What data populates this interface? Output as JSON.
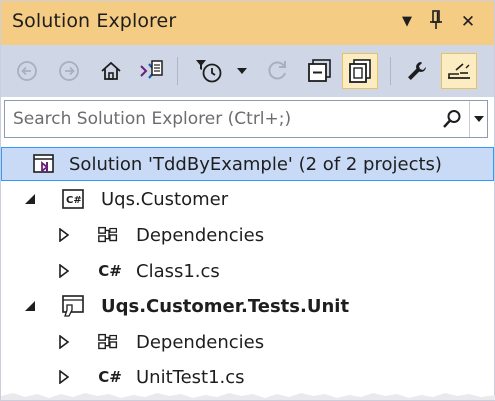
{
  "window": {
    "title": "Solution Explorer",
    "controls": {
      "dropdown": "▼",
      "pin": "pin-icon",
      "close": "✕"
    }
  },
  "toolbar": {
    "buttons": [
      {
        "icon": "back-icon",
        "enabled": false
      },
      {
        "icon": "forward-icon",
        "enabled": false
      },
      {
        "icon": "home-icon",
        "enabled": true
      },
      {
        "icon": "switch-views-icon",
        "enabled": true
      },
      {
        "icon": "pending-changes-filter-icon",
        "enabled": true
      },
      {
        "icon": "sync-icon",
        "enabled": false
      },
      {
        "icon": "collapse-all-icon",
        "enabled": true
      },
      {
        "icon": "show-all-files-icon",
        "enabled": true,
        "checked": true
      },
      {
        "icon": "properties-wrench-icon",
        "enabled": true
      },
      {
        "icon": "preview-selected-items-icon",
        "enabled": true,
        "checked": true
      }
    ],
    "colors": {
      "bg": "#cfd6e5",
      "checked": "#fcecc1"
    }
  },
  "search": {
    "placeholder": "Search Solution Explorer (Ctrl+;)",
    "value": ""
  },
  "tree": {
    "solution": {
      "label": "Solution 'TddByExample' (2 of 2 projects)",
      "selected": true
    },
    "items": [
      {
        "label": "Uqs.Customer",
        "type": "csharp-project",
        "expanded": true,
        "bold": false
      },
      {
        "label": "Dependencies",
        "type": "dependencies",
        "expanded": false
      },
      {
        "label": "Class1.cs",
        "type": "csharp-file",
        "expanded": false,
        "badge": "C#"
      },
      {
        "label": "Uqs.Customer.Tests.Unit",
        "type": "test-project",
        "expanded": true,
        "bold": true
      },
      {
        "label": "Dependencies",
        "type": "dependencies",
        "expanded": false
      },
      {
        "label": "UnitTest1.cs",
        "type": "csharp-file",
        "expanded": false,
        "badge": "C#"
      }
    ]
  },
  "colors": {
    "titlebar": "#f5cc84",
    "selection": "#c9daf6",
    "selection_border": "#3399ff",
    "vs_purple": "#68217a"
  }
}
